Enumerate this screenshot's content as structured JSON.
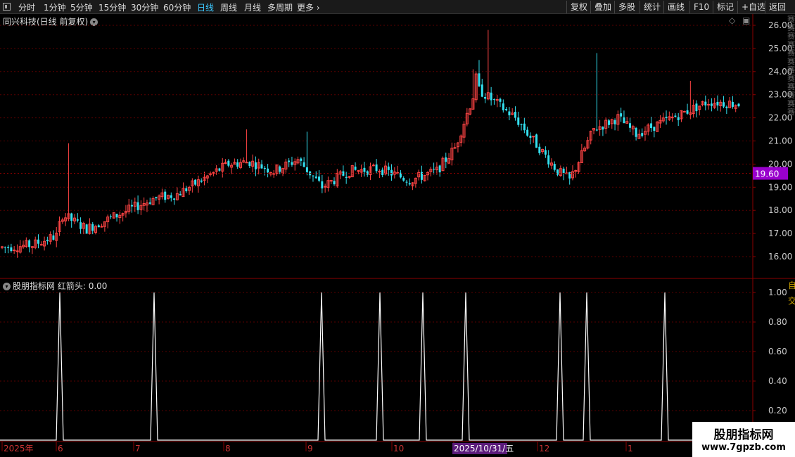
{
  "toolbar": {
    "periods": [
      {
        "label": "分时",
        "active": false
      },
      {
        "label": "1分钟",
        "active": false
      },
      {
        "label": "5分钟",
        "active": false
      },
      {
        "label": "15分钟",
        "active": false
      },
      {
        "label": "30分钟",
        "active": false
      },
      {
        "label": "60分钟",
        "active": false
      },
      {
        "label": "日线",
        "active": true
      },
      {
        "label": "周线",
        "active": false
      },
      {
        "label": "月线",
        "active": false
      },
      {
        "label": "多周期",
        "active": false
      },
      {
        "label": "更多",
        "active": false
      }
    ],
    "right_buttons": [
      "复权",
      "叠加",
      "多股",
      "统计",
      "画线",
      "F10",
      "标记",
      "+自选",
      "返回"
    ]
  },
  "main_panel": {
    "title": "同兴科技(日线 前复权)",
    "price_axis": [
      "26.00",
      "25.00",
      "24.00",
      "23.00",
      "22.00",
      "21.00",
      "20.00",
      "19.00",
      "18.00",
      "17.00",
      "16.00"
    ],
    "current_price": "19.60",
    "colors": {
      "up": "#ff4444",
      "down": "#33e0f0",
      "current_bg": "#9900cc"
    }
  },
  "indicator_panel": {
    "title": "股朋指标网",
    "series_label": "红箭头: 0.00",
    "axis": [
      "1.00",
      "0.80",
      "0.60",
      "0.40",
      "0.20"
    ],
    "side_labels": [
      "自",
      "交"
    ]
  },
  "time_axis": {
    "labels": [
      "2025年",
      "6",
      "7",
      "8",
      "9",
      "10",
      "2025/10/31/五",
      "12",
      "1"
    ]
  },
  "watermark": {
    "title": "股朋指标网",
    "url": "www.7gpzb.com"
  },
  "right_side_text": "赛赛赛赛赛赛赛赛赛赛赛赛",
  "chart_data": [
    {
      "type": "candlestick",
      "title": "同兴科技(日线 前复权)",
      "ylim": [
        15.5,
        26.5
      ],
      "yticks": [
        16,
        17,
        18,
        19,
        20,
        21,
        22,
        23,
        24,
        25,
        26
      ],
      "x_labels": [
        "2025年",
        "6",
        "7",
        "8",
        "9",
        "10",
        "2025/10/31/五",
        "12",
        "1"
      ],
      "current_price": 19.6,
      "waypoints": [
        [
          0,
          16.4
        ],
        [
          10,
          16.5
        ],
        [
          18,
          16.9
        ],
        [
          20,
          17.8
        ],
        [
          28,
          17.2
        ],
        [
          40,
          17.9
        ],
        [
          50,
          18.5
        ],
        [
          58,
          18.7
        ],
        [
          66,
          19.3
        ],
        [
          75,
          20.0
        ],
        [
          82,
          20.1
        ],
        [
          90,
          19.7
        ],
        [
          98,
          20.2
        ],
        [
          106,
          19.0
        ],
        [
          115,
          19.7
        ],
        [
          125,
          19.8
        ],
        [
          135,
          19.3
        ],
        [
          144,
          19.7
        ],
        [
          150,
          20.7
        ],
        [
          157,
          23.3
        ],
        [
          170,
          22.0
        ],
        [
          184,
          19.7
        ],
        [
          188,
          19.3
        ],
        [
          196,
          21.5
        ],
        [
          204,
          22.0
        ],
        [
          210,
          21.3
        ],
        [
          222,
          22.0
        ],
        [
          234,
          22.7
        ],
        [
          244,
          22.6
        ]
      ],
      "spikes": [
        [
          22,
          20.9
        ],
        [
          81,
          21.5
        ],
        [
          101,
          21.4
        ],
        [
          156,
          24.1
        ],
        [
          158,
          24.5
        ],
        [
          161,
          25.8
        ],
        [
          197,
          24.8
        ],
        [
          228,
          23.6
        ]
      ]
    },
    {
      "type": "line",
      "series": [
        {
          "name": "红箭头",
          "values_at_peaks": [
            1,
            1,
            1,
            1,
            1,
            1,
            1,
            1,
            1
          ],
          "baseline": 0
        }
      ],
      "ylim": [
        0,
        1
      ],
      "peak_x": [
        85,
        219,
        457,
        540,
        601,
        662,
        796,
        834,
        945
      ]
    }
  ]
}
